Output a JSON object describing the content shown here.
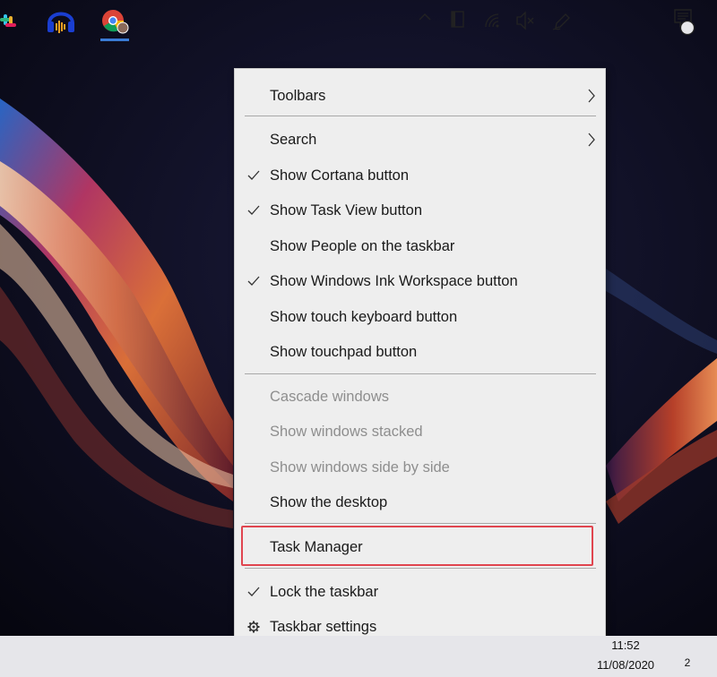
{
  "context_menu": {
    "items": [
      {
        "label": "Toolbars",
        "checked": false,
        "submenu": true,
        "enabled": true
      },
      {
        "label": "Search",
        "checked": false,
        "submenu": true,
        "enabled": true
      },
      {
        "label": "Show Cortana button",
        "checked": true,
        "submenu": false,
        "enabled": true
      },
      {
        "label": "Show Task View button",
        "checked": true,
        "submenu": false,
        "enabled": true
      },
      {
        "label": "Show People on the taskbar",
        "checked": false,
        "submenu": false,
        "enabled": true
      },
      {
        "label": "Show Windows Ink Workspace button",
        "checked": true,
        "submenu": false,
        "enabled": true
      },
      {
        "label": "Show touch keyboard button",
        "checked": false,
        "submenu": false,
        "enabled": true
      },
      {
        "label": "Show touchpad button",
        "checked": false,
        "submenu": false,
        "enabled": true
      },
      {
        "label": "Cascade windows",
        "checked": false,
        "submenu": false,
        "enabled": false
      },
      {
        "label": "Show windows stacked",
        "checked": false,
        "submenu": false,
        "enabled": false
      },
      {
        "label": "Show windows side by side",
        "checked": false,
        "submenu": false,
        "enabled": false
      },
      {
        "label": "Show the desktop",
        "checked": false,
        "submenu": false,
        "enabled": true
      },
      {
        "label": "Task Manager",
        "checked": false,
        "submenu": false,
        "enabled": true,
        "highlighted": true
      },
      {
        "label": "Lock the taskbar",
        "checked": true,
        "submenu": false,
        "enabled": true
      },
      {
        "label": "Taskbar settings",
        "checked": false,
        "submenu": false,
        "enabled": true,
        "icon": "gear-icon"
      }
    ]
  },
  "taskbar": {
    "pinned_apps": [
      "slack-icon",
      "audacity-icon",
      "chrome-icon"
    ],
    "tray_icons": [
      "chevron-up-icon",
      "tablet-icon",
      "wifi-icon",
      "volume-muted-icon",
      "pen-icon"
    ],
    "clock_time": "11:52",
    "clock_date": "11/08/2020",
    "notification_count": "2"
  },
  "colors": {
    "menu_background": "#eeeeee",
    "highlight_border": "#e0454f",
    "disabled_text": "#8e8e8e"
  }
}
